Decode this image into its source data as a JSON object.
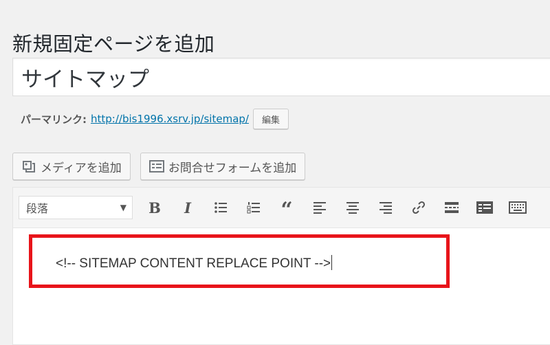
{
  "page_title": "新規固定ページを追加",
  "post_title": {
    "value": "サイトマップ"
  },
  "permalink": {
    "label": "パーマリンク:",
    "url_prefix": "http://bis1996.xsrv.jp/",
    "slug": "sitemap/",
    "edit_label": "編集"
  },
  "media_buttons": {
    "add_media": {
      "label": "メディアを追加",
      "icon": "media-icon"
    },
    "add_contact_form": {
      "label": "お問合せフォームを追加",
      "icon": "form-icon"
    }
  },
  "toolbar": {
    "format_value": "段落",
    "buttons": [
      "bold",
      "italic",
      "bulleted-list",
      "numbered-list",
      "blockquote",
      "align-left",
      "align-center",
      "align-right",
      "link",
      "read-more",
      "toolbar-toggle",
      "keyboard"
    ]
  },
  "editor": {
    "content": "<!-- SITEMAP CONTENT REPLACE POINT -->"
  },
  "colors": {
    "highlight": "#e8141a",
    "link": "#0073aa"
  }
}
